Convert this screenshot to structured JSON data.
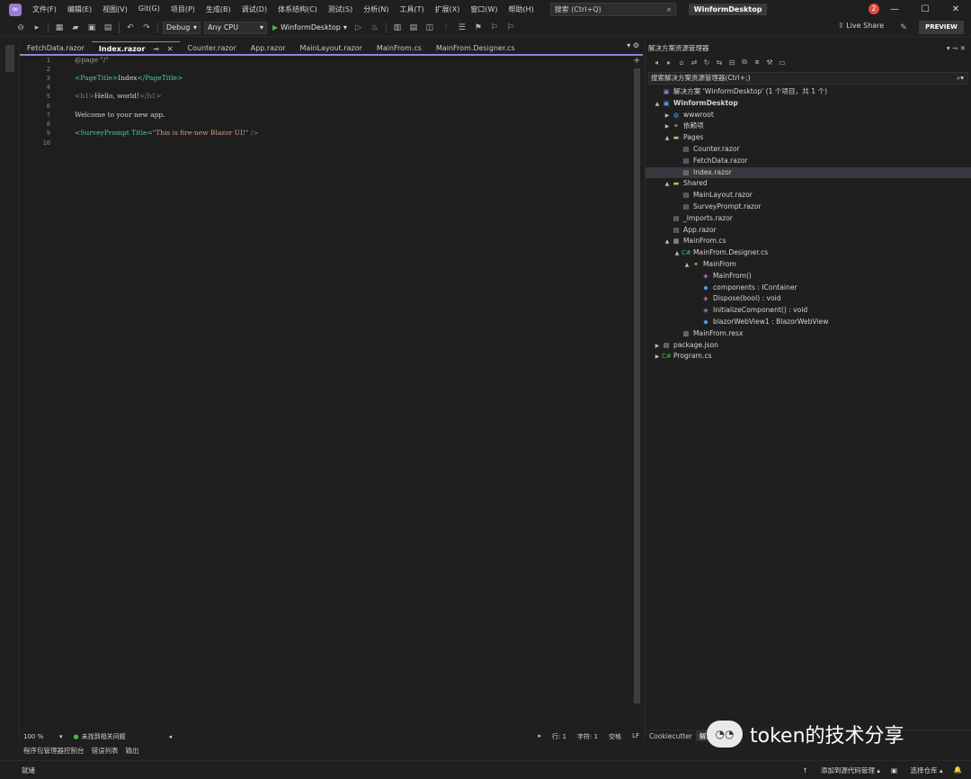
{
  "menu": [
    "文件(F)",
    "编辑(E)",
    "视图(V)",
    "Git(G)",
    "项目(P)",
    "生成(B)",
    "调试(D)",
    "体系结构(C)",
    "测试(S)",
    "分析(N)",
    "工具(T)",
    "扩展(X)",
    "窗口(W)",
    "帮助(H)"
  ],
  "search": {
    "placeholder": "搜索 (Ctrl+Q)"
  },
  "project_name": "WinformDesktop",
  "notification_count": "2",
  "toolbar": {
    "config": "Debug",
    "platform": "Any CPU",
    "run_target": "WinformDesktop",
    "live_share": "Live Share",
    "preview": "PREVIEW"
  },
  "tabs": [
    {
      "label": "FetchData.razor",
      "active": false
    },
    {
      "label": "Index.razor",
      "active": true
    },
    {
      "label": "Counter.razor",
      "active": false
    },
    {
      "label": "App.razor",
      "active": false
    },
    {
      "label": "MainLayout.razor",
      "active": false
    },
    {
      "label": "MainFrom.cs",
      "active": false
    },
    {
      "label": "MainFrom.Designer.cs",
      "active": false
    }
  ],
  "editor": {
    "line_numbers": [
      "1",
      "2",
      "3",
      "4",
      "5",
      "6",
      "7",
      "8",
      "9",
      "10"
    ],
    "lines": {
      "l1_dir": "@page \"/\"",
      "l3_open": "<PageTitle>",
      "l3_text": "Index",
      "l3_close": "</PageTitle>",
      "l5_open": "<h1>",
      "l5_text": "Hello, world!",
      "l5_close": "</h1>",
      "l7_text": "Welcome to your new app.",
      "l9_tag": "<SurveyPrompt",
      "l9_attr": " Title=",
      "l9_str": "\"This is fire-new Blazor UI!\"",
      "l9_end": " />"
    }
  },
  "editor_status": {
    "zoom": "100 %",
    "issues": "未找到相关问题",
    "line": "行: 1",
    "col": "字符: 1",
    "whitespace": "空格",
    "eol": "LF"
  },
  "bottom_tabs": [
    "程序包管理器控制台",
    "错误列表",
    "输出"
  ],
  "solution_explorer": {
    "title": "解决方案资源管理器",
    "search_placeholder": "搜索解决方案资源管理器(Ctrl+;)",
    "tree": [
      {
        "label": "解决方案 'WinformDesktop' (1 个项目，共 1 个)",
        "level": 0,
        "icon": "solution-icon",
        "arrow": ""
      },
      {
        "label": "WinformDesktop",
        "level": 0,
        "icon": "project-icon",
        "arrow": "▲",
        "bold": true
      },
      {
        "label": "wwwroot",
        "level": 1,
        "icon": "globe-icon",
        "arrow": "▶"
      },
      {
        "label": "依赖项",
        "level": 1,
        "icon": "dependencies-icon",
        "arrow": "▶"
      },
      {
        "label": "Pages",
        "level": 1,
        "icon": "folder-icon",
        "arrow": "▲"
      },
      {
        "label": "Counter.razor",
        "level": 2,
        "icon": "razor-file-icon",
        "arrow": ""
      },
      {
        "label": "FetchData.razor",
        "level": 2,
        "icon": "razor-file-icon",
        "arrow": ""
      },
      {
        "label": "Index.razor",
        "level": 2,
        "icon": "razor-file-icon",
        "arrow": "",
        "selected": true
      },
      {
        "label": "Shared",
        "level": 1,
        "icon": "folder-icon",
        "arrow": "▲"
      },
      {
        "label": "MainLayout.razor",
        "level": 2,
        "icon": "razor-file-icon",
        "arrow": ""
      },
      {
        "label": "SurveyPrompt.razor",
        "level": 2,
        "icon": "razor-file-icon",
        "arrow": ""
      },
      {
        "label": "_Imports.razor",
        "level": 1,
        "icon": "razor-file-icon",
        "arrow": ""
      },
      {
        "label": "App.razor",
        "level": 1,
        "icon": "razor-file-icon",
        "arrow": ""
      },
      {
        "label": "MainFrom.cs",
        "level": 1,
        "icon": "form-icon",
        "arrow": "▲"
      },
      {
        "label": "MainFrom.Designer.cs",
        "level": 2,
        "icon": "csharp-file-icon",
        "arrow": "▲"
      },
      {
        "label": "MainFrom",
        "level": 3,
        "icon": "class-icon",
        "arrow": "▲"
      },
      {
        "label": "MainFrom()",
        "level": 4,
        "icon": "method-icon",
        "arrow": ""
      },
      {
        "label": "components : IContainer",
        "level": 4,
        "icon": "field-icon",
        "arrow": ""
      },
      {
        "label": "Dispose(bool) : void",
        "level": 4,
        "icon": "method-icon",
        "arrow": ""
      },
      {
        "label": "InitializeComponent() : void",
        "level": 4,
        "icon": "method-icon",
        "arrow": ""
      },
      {
        "label": "blazorWebView1 : BlazorWebView",
        "level": 4,
        "icon": "field-icon",
        "arrow": ""
      },
      {
        "label": "MainFrom.resx",
        "level": 2,
        "icon": "resx-file-icon",
        "arrow": ""
      },
      {
        "label": "package.json",
        "level": 0,
        "icon": "json-file-icon",
        "arrow": "▶"
      },
      {
        "label": "Program.cs",
        "level": 0,
        "icon": "csharp-file-icon",
        "arrow": "▶"
      }
    ],
    "bottom_tabs": [
      "Cookiecutter",
      "解决方"
    ]
  },
  "status_bar": {
    "ready": "就绪",
    "add_source_control": "添加到源代码管理",
    "select_repo": "选择仓库"
  },
  "watermark": "token的技术分享",
  "colors": {
    "accent": "#9b7dd6",
    "tag": "#4ec9b0",
    "string": "#d69d85",
    "run": "#3fbf4a",
    "notification": "#e5483f"
  }
}
